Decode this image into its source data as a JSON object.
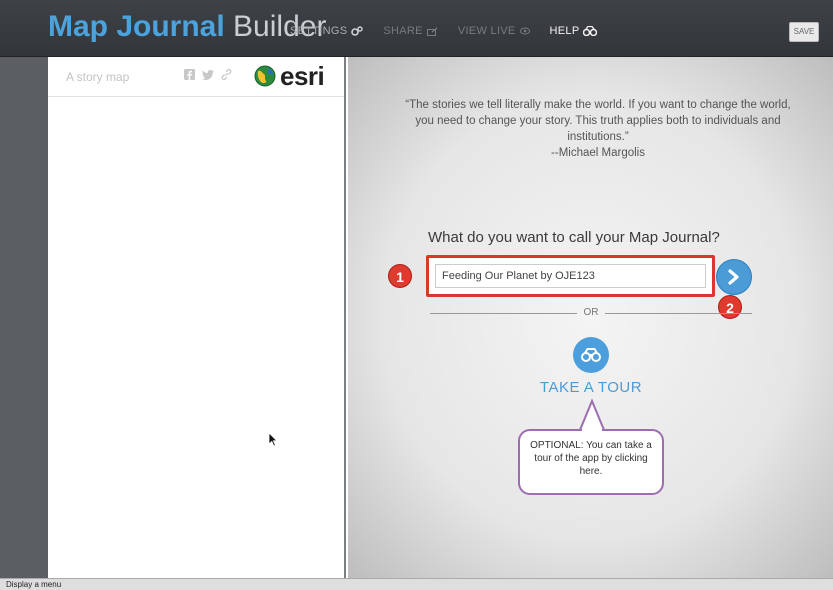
{
  "header": {
    "title_part1": "Map Journal",
    "title_part2": "Builder",
    "nav": [
      {
        "label": "SETTINGS",
        "icon": "gears-icon"
      },
      {
        "label": "SHARE",
        "icon": "share-icon"
      },
      {
        "label": "VIEW LIVE",
        "icon": "eye-icon"
      },
      {
        "label": "HELP",
        "icon": "binoculars-icon"
      }
    ],
    "save_label": "SAVE"
  },
  "side_panel": {
    "story_label": "A story map",
    "social_icons": [
      "facebook-icon",
      "twitter-icon",
      "link-icon"
    ],
    "logo_text": "esri"
  },
  "main": {
    "quote": "“The stories we tell literally make the world. If you want to change the world, you need to change your story. This truth applies both to individuals and institutions.”",
    "quote_author": "--Michael Margolis",
    "question": "What do you want to call your Map Journal?",
    "title_input_value": "Feeding Our Planet by OJE123",
    "or_label": "OR",
    "tour_label": "TAKE A TOUR",
    "callout_text": "OPTIONAL: You can take a tour of the app by clicking here.",
    "badge_1": "1",
    "badge_2": "2"
  },
  "status_bar": {
    "text": "Display a menu"
  },
  "colors": {
    "accent_blue": "#4a9bd6",
    "badge_red": "#e0392e",
    "callout_border": "#9c6db1"
  }
}
